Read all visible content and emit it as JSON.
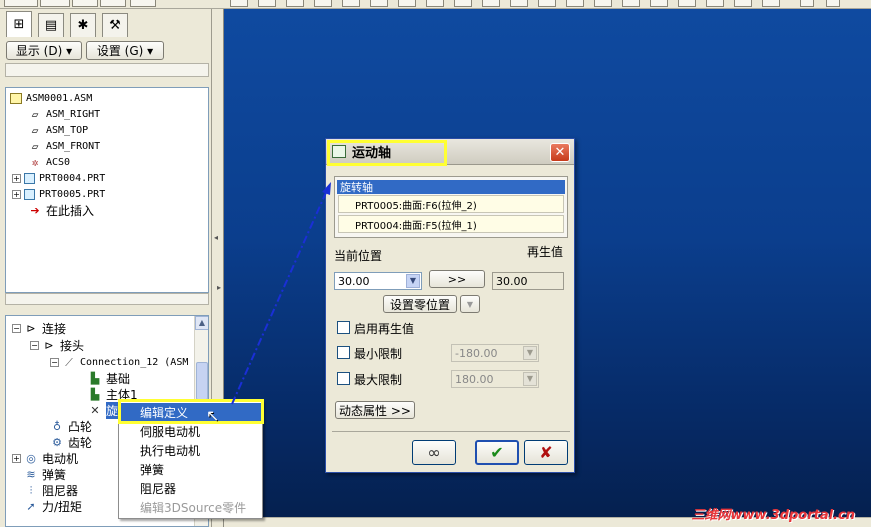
{
  "left_panel": {
    "show_button": "显示 (D) ▾",
    "settings_button": "设置 (G) ▾",
    "model_tree": [
      {
        "label": "ASM0001.ASM",
        "icon": "assembly-icon",
        "expand": ""
      },
      {
        "label": "ASM_RIGHT",
        "icon": "datum-plane-icon",
        "expand": ""
      },
      {
        "label": "ASM_TOP",
        "icon": "datum-plane-icon",
        "expand": ""
      },
      {
        "label": "ASM_FRONT",
        "icon": "datum-plane-icon",
        "expand": ""
      },
      {
        "label": "ACS0",
        "icon": "coordinate-system-icon",
        "expand": ""
      },
      {
        "label": "PRT0004.PRT",
        "icon": "part-icon",
        "expand": "+"
      },
      {
        "label": "PRT0005.PRT",
        "icon": "part-icon",
        "expand": "+"
      },
      {
        "label": "在此插入",
        "icon": "insert-here-arrow-icon",
        "expand": ""
      }
    ],
    "mech_tree": [
      {
        "label": "连接"
      },
      {
        "label": "接头"
      },
      {
        "label": "Connection_12 (ASM"
      },
      {
        "label": "基础"
      },
      {
        "label": "主体1"
      },
      {
        "label": "旋转轴"
      },
      {
        "label": "凸轮"
      },
      {
        "label": "齿轮"
      },
      {
        "label": "电动机"
      },
      {
        "label": "弹簧"
      },
      {
        "label": "阻尼器"
      },
      {
        "label": "力/扭矩"
      }
    ]
  },
  "context_menu": {
    "items": [
      {
        "label": "编辑定义",
        "highlighted": true,
        "enabled": true
      },
      {
        "label": "伺服电动机",
        "highlighted": false,
        "enabled": true
      },
      {
        "label": "执行电动机",
        "highlighted": false,
        "enabled": true
      },
      {
        "label": "弹簧",
        "highlighted": false,
        "enabled": true
      },
      {
        "label": "阻尼器",
        "highlighted": false,
        "enabled": true
      },
      {
        "label": "编辑3DSource零件",
        "highlighted": false,
        "enabled": false
      }
    ]
  },
  "dialog": {
    "title": "运动轴",
    "close": "✕",
    "axis_header": "旋转轴",
    "axis_refs": [
      "PRT0005:曲面:F6(拉伸_2)",
      "PRT0004:曲面:F5(拉伸_1)"
    ],
    "current_position_label": "当前位置",
    "regen_value_label": "再生值",
    "current_position_value": "30.00",
    "transfer_button": ">>",
    "regen_value": "30.00",
    "set_zero_button": "设置零位置",
    "enable_regen_label": "启用再生值",
    "min_limit_label": "最小限制",
    "min_limit_value": "-180.00",
    "max_limit_label": "最大限制",
    "max_limit_value": "180.00",
    "dynamic_props_button": "动态属性 >>",
    "preview_button": "∞",
    "ok_button": "✔",
    "cancel_button": "✘"
  },
  "colors": {
    "highlight_yellow": "#ffff33",
    "selection_blue": "#316ac5",
    "background_top": "#0f4aa0",
    "background_bottom": "#05204f"
  },
  "watermark": "三维网www.3dportal.cn"
}
